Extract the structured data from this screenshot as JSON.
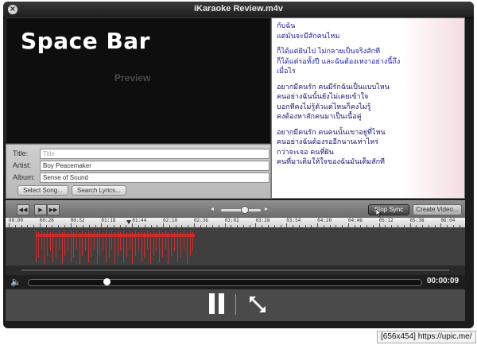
{
  "window": {
    "title": "iKaraoke Review.m4v"
  },
  "video": {
    "title": "Space Bar",
    "overlay": "Preview"
  },
  "metadata": {
    "title_label": "Title:",
    "title_placeholder": "Title",
    "artist_label": "Artist:",
    "artist_value": "Boy Peacemaker",
    "album_label": "Album:",
    "album_value": "Sense of Sound",
    "select_song_label": "Select Song...",
    "search_lyrics_label": "Search Lyrics..."
  },
  "lyrics": {
    "lines": [
      "กับฉัน",
      "แต่มันจะมีสักคนไหม",
      "",
      "ก็ได้แต่ฝันไป ไม่กลายเป็นจริงสักที",
      "ก็ได้แต่รอทั้งปี และฉันต้องเหงาอย่างนี้ถึง",
      "เมื่อไร",
      "",
      "อยากมีคนรัก คนมีรักฉันเป็นแบบไหน",
      "คนอย่างฉันนั้นยังไม่เคยเข้าใจ",
      "บอกทีคงไม่รู้ตัวแต่ไหนก็คงไม่รู้",
      "คงต้องหาสักคนมาเป็นเนื้อคู่",
      "",
      "อยากมีคนรัก คนคนนั้นเขาอยู่ที่ไหน",
      "คนอย่างฉันต้องรออีกนานเท่าไหร่",
      "กว่าจะเจอ คนที่ฝัน",
      "คนที่มาเติมให้ใจของฉันมันเต็มสักที"
    ],
    "colors": {
      "active": "#1a1aa8",
      "rest": "#14146e"
    }
  },
  "controls": {
    "prev_label": "◀◀",
    "play_label": "▶",
    "next_label": "▶▶",
    "stop_sync_label": "Stop Sync",
    "create_video_label": "Create Video..."
  },
  "timeline": {
    "ticks": [
      "00:00",
      "00:26",
      "00:52",
      "01:18",
      "01:44",
      "02:10",
      "02:36",
      "03:02",
      "03:28",
      "03:54",
      "04:20",
      "04:46",
      "05:12",
      "05:38",
      "06:04"
    ],
    "clip_color": "#d82a2a"
  },
  "player": {
    "time": "00:00:09",
    "progress": 0.2
  },
  "watermark": "[656x454] https://upic.me/"
}
